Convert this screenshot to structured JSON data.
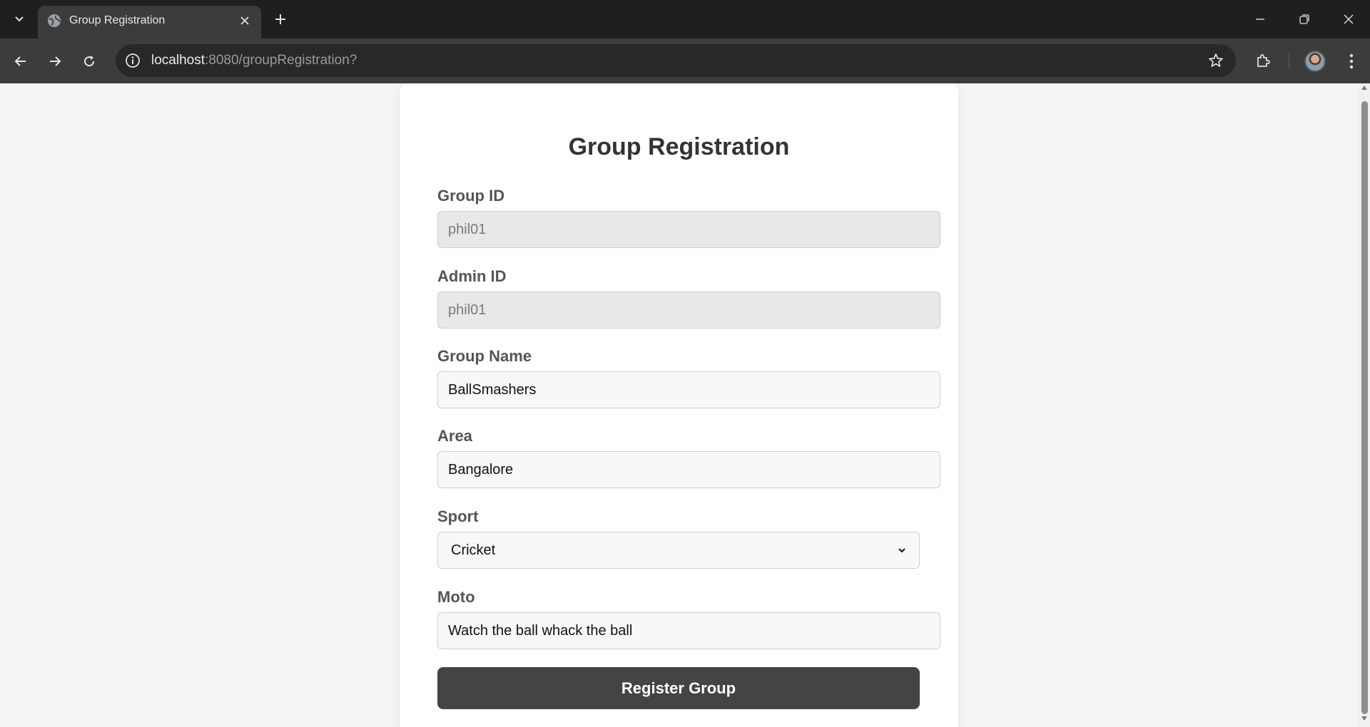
{
  "browser": {
    "tab": {
      "title": "Group Registration",
      "favicon": "globe-icon"
    },
    "address": {
      "host": "localhost",
      "path": ":8080/groupRegistration?"
    },
    "colors": {
      "frame": "#1f1f1f",
      "toolbar": "#3c3c3c",
      "omnibox": "#282828"
    }
  },
  "page": {
    "title": "Group Registration",
    "fields": {
      "group_id": {
        "label": "Group ID",
        "value": "phil01",
        "disabled": true
      },
      "admin_id": {
        "label": "Admin ID",
        "value": "phil01",
        "disabled": true
      },
      "group_name": {
        "label": "Group Name",
        "value": "BallSmashers"
      },
      "area": {
        "label": "Area",
        "value": "Bangalore"
      },
      "sport": {
        "label": "Sport",
        "selected": "Cricket"
      },
      "moto": {
        "label": "Moto",
        "value": "Watch the ball whack the ball"
      }
    },
    "submit_label": "Register Group",
    "colors": {
      "background": "#f4f4f4",
      "card": "#ffffff",
      "button": "#444444",
      "label": "#555555",
      "title": "#333333"
    }
  }
}
